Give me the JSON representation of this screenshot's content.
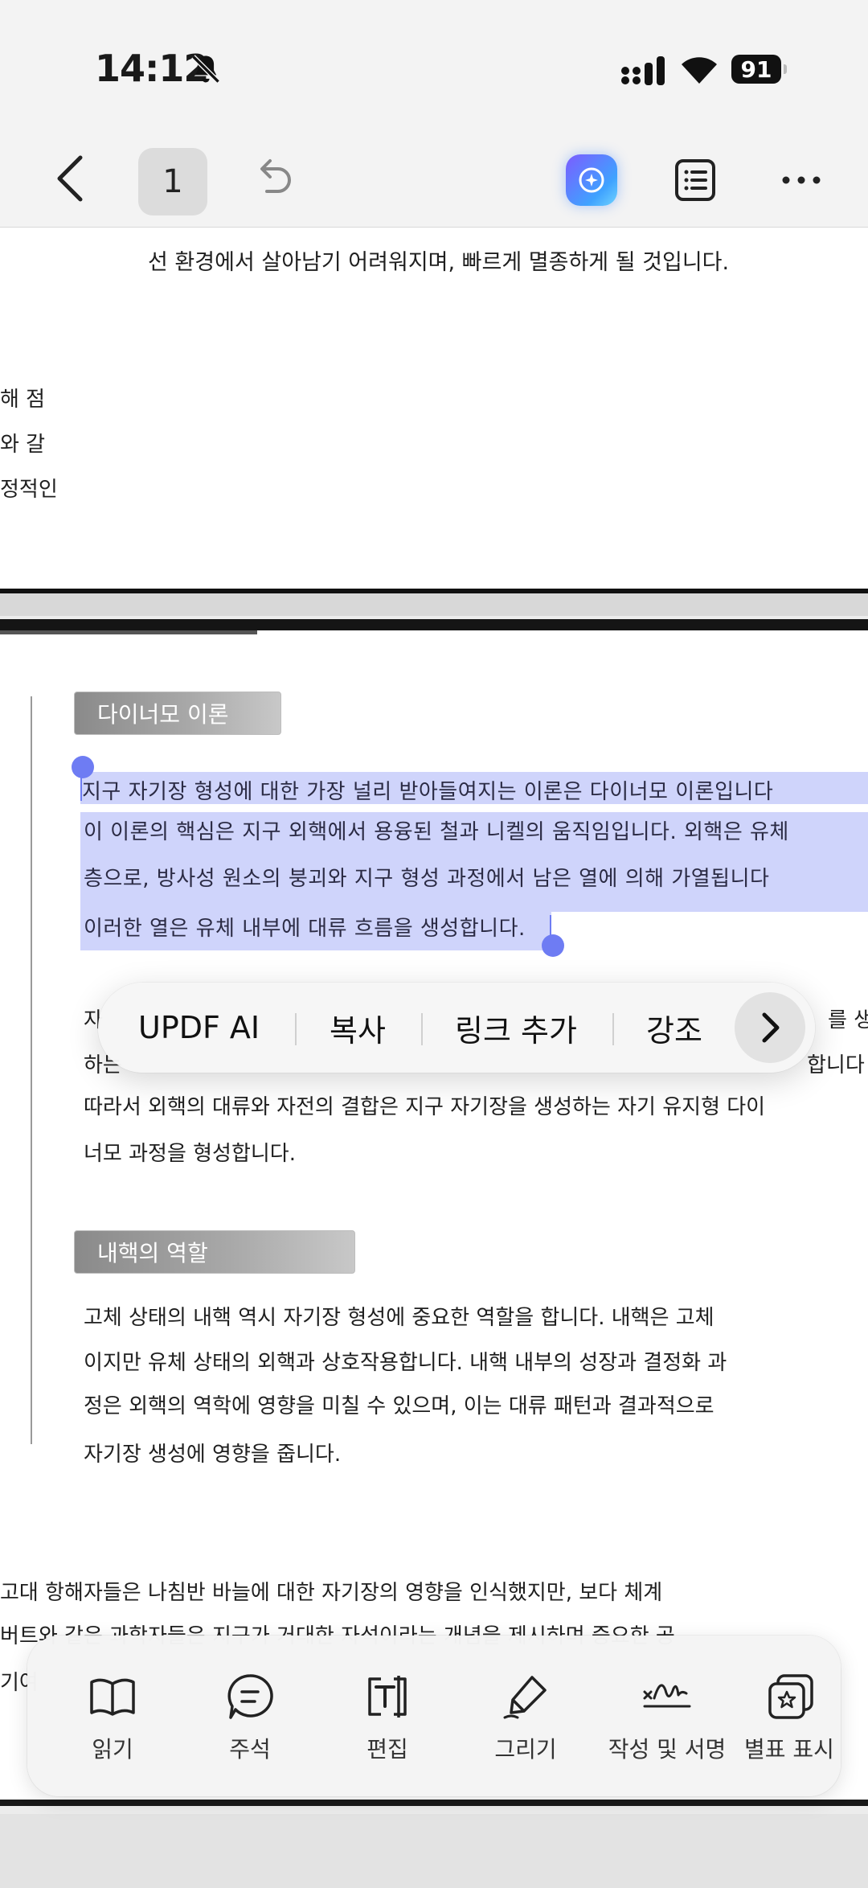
{
  "status_bar": {
    "time": "14:12",
    "battery": "91"
  },
  "toolbar": {
    "page_number": "1"
  },
  "document": {
    "page1": {
      "top_line": "선 환경에서 살아남기 어려워지며, 빠르게 멸종하게 될 것입니다.",
      "left_fragments": [
        "해 점",
        "와 갈",
        "정적인"
      ]
    },
    "page2": {
      "heading1": "다이너모 이론",
      "selected_lines": [
        "지구 자기장 형성에 대한 가장 널리 받아들여지는 이론은 다이너모 이론입니다",
        "이 이론의 핵심은 지구 외핵에서 용융된 철과 니켈의 움직임입니다. 외핵은 유체",
        "층으로, 방사성 원소의 붕괴와 지구 형성 과정에서 남은 열에 의해 가열됩니다",
        "이러한 열은 유체 내부에 대류 흐름을 생성합니다."
      ],
      "para1_line1_start": "자",
      "para1_line1_end": "를 생성",
      "para1_line2_start": "하는",
      "para1_line2_end": "합니다",
      "para1_line3": "따라서 외핵의 대류와 자전의 결합은 지구 자기장을 생성하는 자기 유지형 다이",
      "para1_line4": "너모 과정을 형성합니다.",
      "heading2": "내핵의 역할",
      "para2": [
        "고체 상태의 내핵 역시 자기장 형성에 중요한 역할을 합니다. 내핵은 고체",
        "이지만 유체 상태의 외핵과 상호작용합니다. 내핵 내부의 성장과 결정화 과",
        "정은 외핵의 역학에 영향을 미칠 수 있으며, 이는 대류 패턴과 결과적으로",
        "자기장 생성에 영향을 줍니다."
      ],
      "para3": [
        "고대 항해자들은 나침반 바늘에 대한 자기장의 영향을 인식했지만, 보다 체계",
        "버트와 같은 과학자들은 지구가 거대한 자석이라는 개념을 제시하며 중요한 공",
        "기여"
      ]
    }
  },
  "context_menu": {
    "items": [
      "UPDF AI",
      "복사",
      "링크 추가",
      "강조"
    ]
  },
  "bottom_toolbar": {
    "items": [
      "읽기",
      "주석",
      "편집",
      "그리기",
      "작성 및 서명",
      "별표 표시"
    ]
  }
}
